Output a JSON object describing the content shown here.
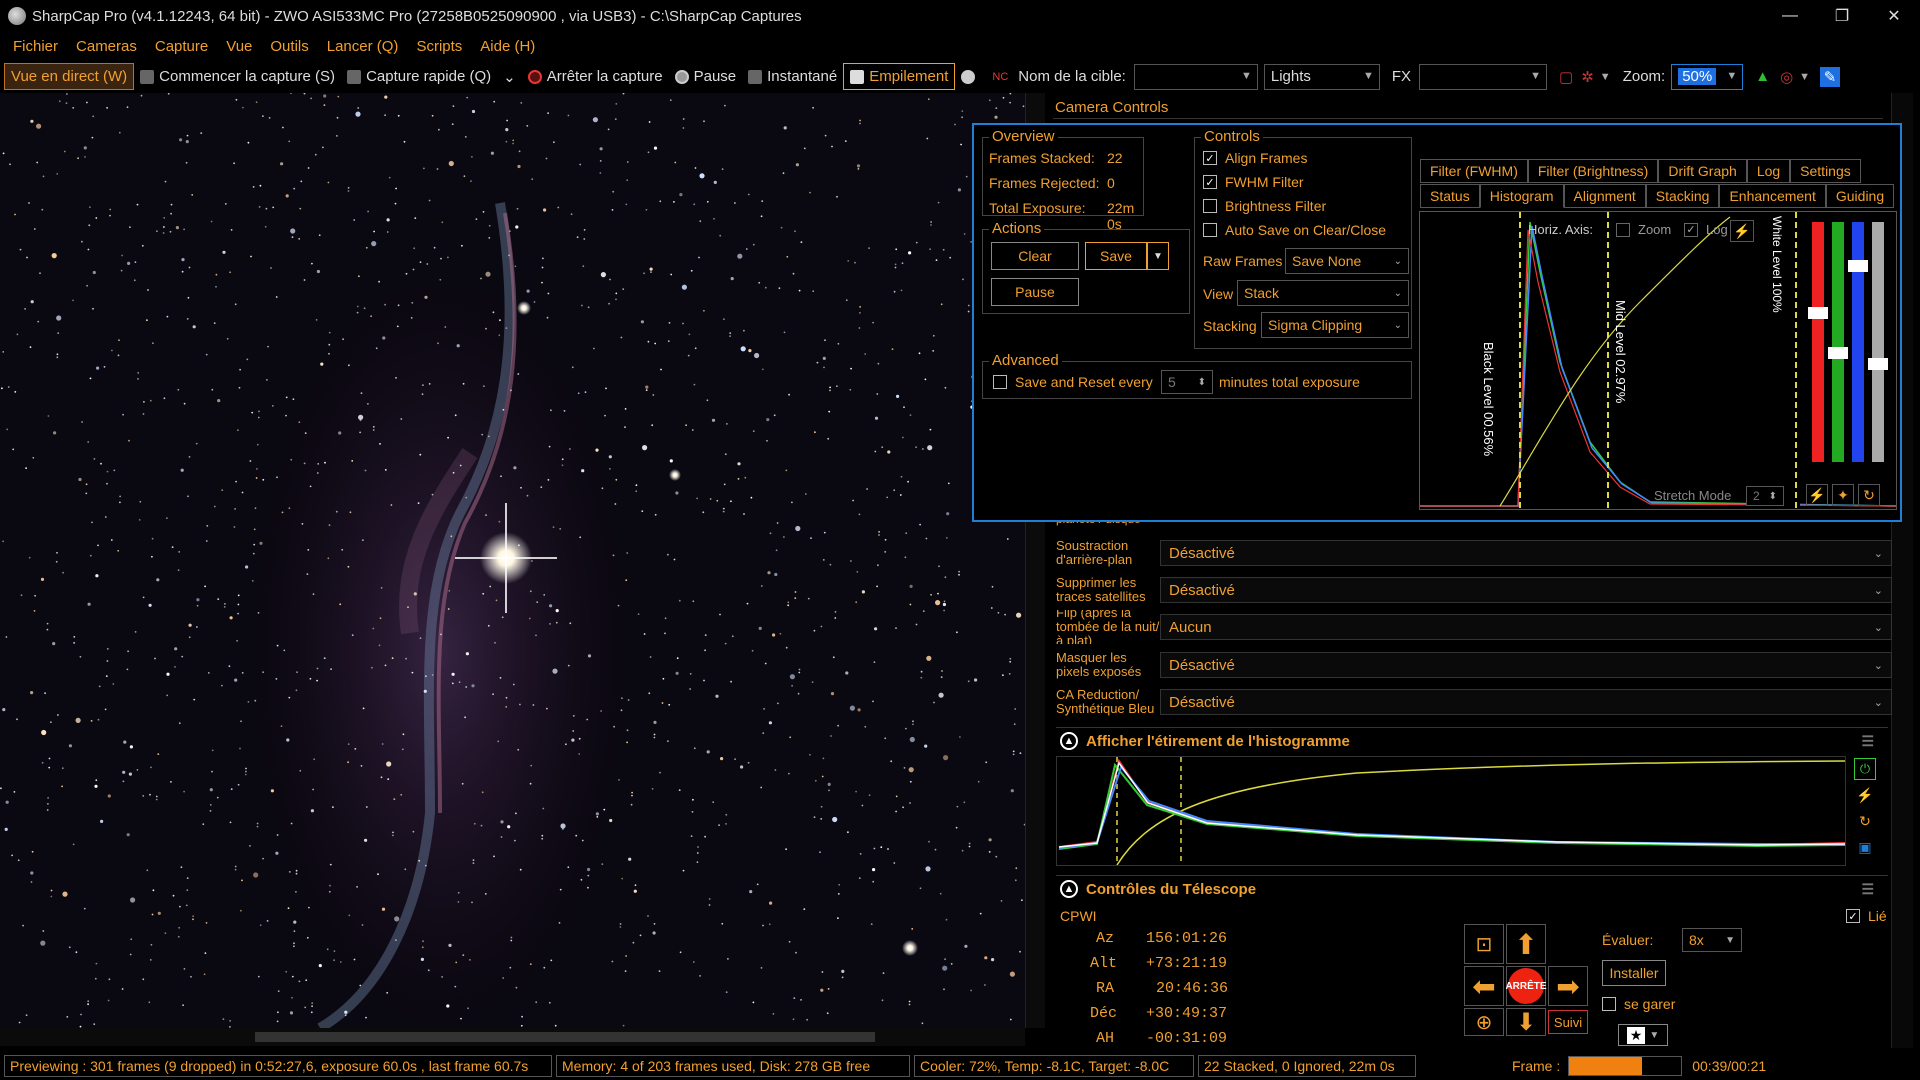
{
  "window": {
    "title": "SharpCap Pro (v4.1.12243, 64 bit) - ZWO ASI533MC Pro (27258B0525090900 , via USB3) - C:\\SharpCap Captures",
    "minimize": "—",
    "maximize": "❐",
    "close": "✕"
  },
  "menu": [
    "Fichier",
    "Cameras",
    "Capture",
    "Vue",
    "Outils",
    "Lancer (Q)",
    "Scripts",
    "Aide (H)"
  ],
  "toolbar": {
    "live_view": "Vue en direct (W)",
    "start_capture": "Commencer la capture (S)",
    "quick_capture": "Capture rapide (Q)",
    "stop_capture": "Arrêter la capture",
    "pause": "Pause",
    "snapshot": "Instantané",
    "stacking": "Empilement",
    "target_label": "Nom de la cible:",
    "target_value": "",
    "frame_type": "Lights",
    "fx_label": "FX",
    "fx_value": "",
    "zoom_label": "Zoom:",
    "zoom_value": "50%"
  },
  "right_panel": {
    "header": "Camera Controls",
    "rows": [
      {
        "label": "planète / disque",
        "value": ""
      },
      {
        "label": "Soustraction d'arrière-plan",
        "value": "Désactivé"
      },
      {
        "label": "Supprimer les traces satellites",
        "value": "Désactivé"
      },
      {
        "label": "Flip (après la tombée de la nuit/à plat)",
        "value": "Aucun"
      },
      {
        "label": "Masquer les pixels exposés",
        "value": "Désactivé"
      },
      {
        "label": "CA Reduction/ Synthétique Bleu",
        "value": "Désactivé"
      }
    ],
    "histogram_section": "Afficher l'étirement de l'histogramme",
    "telescope_section": "Contrôles du Télescope"
  },
  "stacking": {
    "overview_title": "Overview",
    "frames_stacked_label": "Frames Stacked:",
    "frames_stacked": "22",
    "frames_rejected_label": "Frames Rejected:",
    "frames_rejected": "0",
    "total_exposure_label": "Total Exposure:",
    "total_exposure": "22m 0s",
    "actions_title": "Actions",
    "clear": "Clear",
    "save": "Save",
    "pause": "Pause",
    "advanced_title": "Advanced",
    "save_reset_label": "Save and Reset every",
    "save_reset_value": "5",
    "save_reset_suffix": "minutes total exposure",
    "controls_title": "Controls",
    "align_frames": "Align Frames",
    "fwhm_filter": "FWHM Filter",
    "brightness_filter": "Brightness Filter",
    "auto_save": "Auto Save on Clear/Close",
    "raw_frames_label": "Raw Frames",
    "raw_frames_value": "Save None",
    "view_label": "View",
    "view_value": "Stack",
    "stacking_label": "Stacking",
    "stacking_value": "Sigma Clipping",
    "tabs_top": [
      "Filter (FWHM)",
      "Filter (Brightness)",
      "Drift Graph",
      "Log",
      "Settings"
    ],
    "tabs_bottom": [
      "Status",
      "Histogram",
      "Alignment",
      "Stacking",
      "Enhancement",
      "Guiding"
    ],
    "horiz_axis": "Horiz. Axis:",
    "zoom": "Zoom",
    "log": "Log",
    "black_level": "Black Level 00.56%",
    "mid_level": "Mid Level 02.97%",
    "white_level": "White Level 100%",
    "stretch_mode": "Stretch Mode",
    "stretch_value": "2"
  },
  "telescope": {
    "name": "CPWI",
    "linked": "Lié",
    "az_label": "Az",
    "az": "156:01:26",
    "alt_label": "Alt",
    "alt": "+73:21:19",
    "ra_label": "RA",
    "ra": "20:46:36",
    "dec_label": "Déc",
    "dec": "+30:49:37",
    "ah_label": "AH",
    "ah": "-00:31:09",
    "rate_label": "Évaluer:",
    "rate": "8x",
    "setup": "Installer",
    "park": "se garer",
    "stop": "ARRÊTE",
    "tracking": "Suivi"
  },
  "status": {
    "preview": "Previewing : 301 frames (9 dropped) in 0:52:27,6, exposure 60.0s , last frame 60.7s",
    "memory": "Memory: 4 of 203 frames used, Disk: 278 GB free",
    "cooler": "Cooler: 72%, Temp: -8.1C, Target: -8.0C",
    "stacked": "22 Stacked, 0 Ignored, 22m 0s",
    "frame_label": "Frame :",
    "frame_progress": 0.65,
    "time": "00:39/00:21"
  }
}
